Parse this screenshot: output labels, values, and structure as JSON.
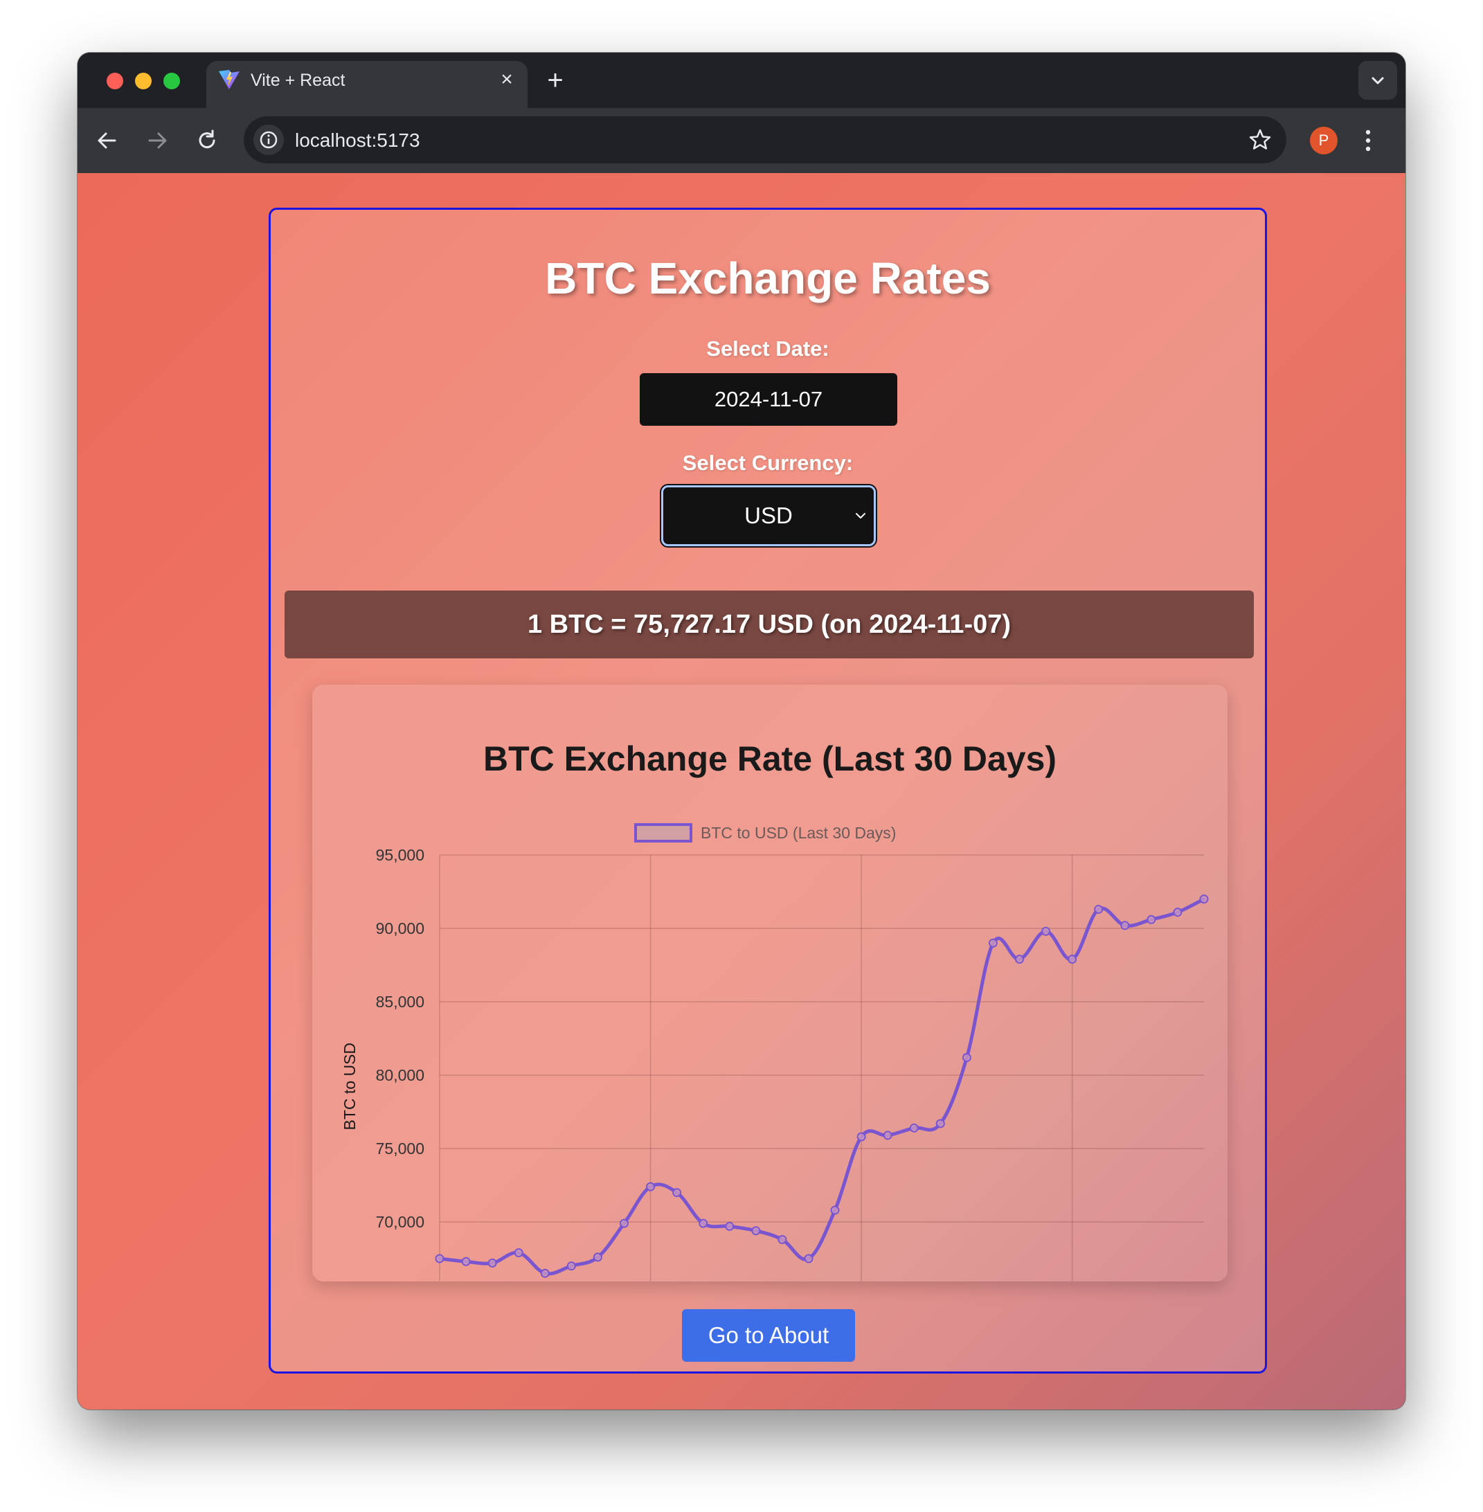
{
  "browser": {
    "tab_title": "Vite + React",
    "url": "localhost:5173",
    "profile_initial": "P",
    "traffic_lights": {
      "close": "#ff5f57",
      "minimize": "#febc2e",
      "zoom": "#28c840"
    }
  },
  "page": {
    "title": "BTC Exchange Rates",
    "date_label": "Select Date:",
    "date_value": "2024-11-07",
    "currency_label": "Select Currency:",
    "currency_value": "USD",
    "result_text": "1 BTC = 75,727.17 USD (on 2024-11-07)",
    "about_button": "Go to About"
  },
  "colors": {
    "accent_blue": "#3d6ee8",
    "line": "#7a55d0",
    "border": "#1c14e0",
    "result_bg": "#794741"
  },
  "chart_data": {
    "type": "line",
    "title": "BTC Exchange Rate (Last 30 Days)",
    "ylabel": "BTC to USD",
    "xlabel": "",
    "legend": "BTC to USD (Last 30 Days)",
    "legend_position": "top",
    "grid": true,
    "ylim": [
      66300,
      95000
    ],
    "yticks": [
      "95,000",
      "90,000",
      "85,000",
      "80,000",
      "75,000",
      "70,000"
    ],
    "ytick_values": [
      95000,
      90000,
      85000,
      80000,
      75000,
      70000
    ],
    "series": [
      {
        "name": "BTC to USD (Last 30 Days)",
        "values": [
          67500,
          67300,
          67200,
          67900,
          66500,
          67000,
          67600,
          69900,
          72400,
          72000,
          69900,
          69700,
          69400,
          68800,
          67500,
          70800,
          75800,
          75900,
          76400,
          76700,
          81200,
          89000,
          87900,
          89800,
          87900,
          91300,
          90200,
          90600,
          91100,
          92000
        ]
      }
    ]
  }
}
